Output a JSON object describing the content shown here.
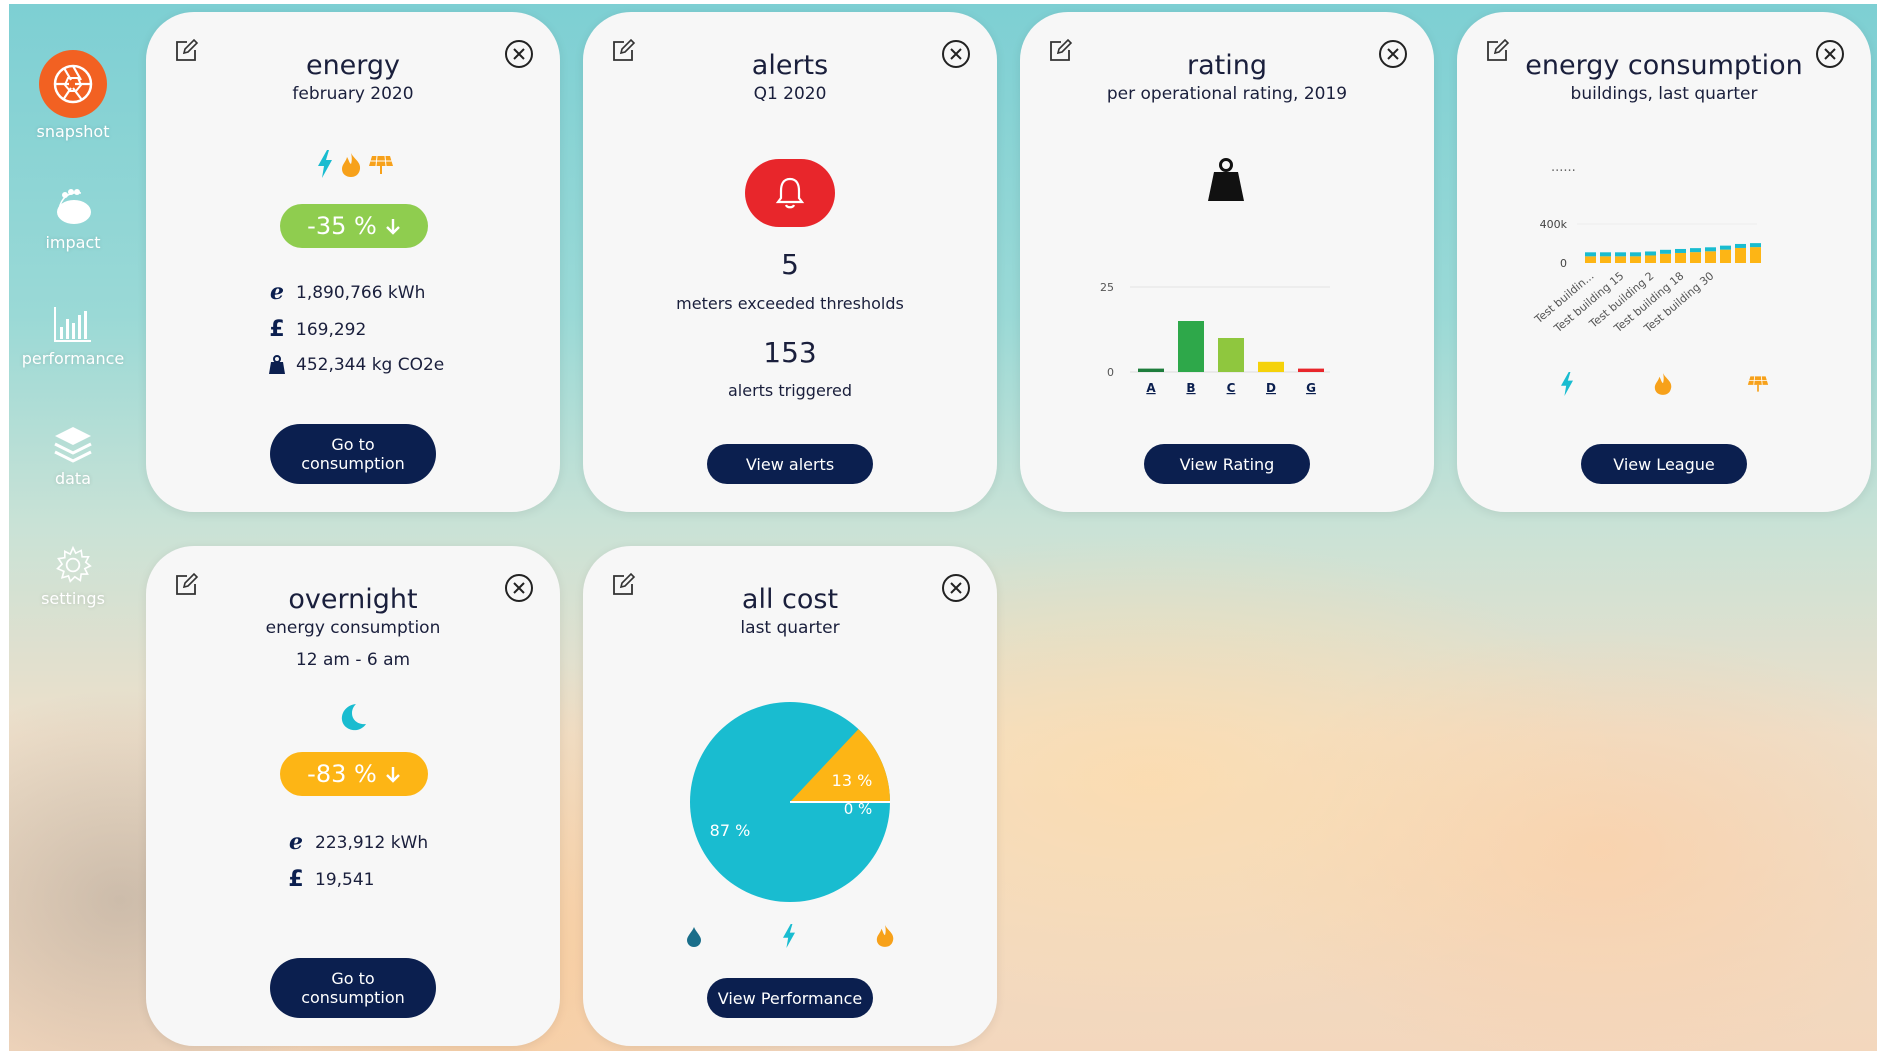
{
  "nav": {
    "items": [
      {
        "label": "snapshot",
        "icon": "shutter-icon"
      },
      {
        "label": "impact",
        "icon": "footprint-icon"
      },
      {
        "label": "performance",
        "icon": "bar-chart-icon"
      },
      {
        "label": "data",
        "icon": "layers-icon"
      },
      {
        "label": "settings",
        "icon": "gear-icon"
      }
    ]
  },
  "colors": {
    "navy": "#0b1f4f",
    "orange": "#f26122",
    "green": "#8fcd4f",
    "amber": "#fdb515",
    "teal": "#19bcd0",
    "red": "#e8262b"
  },
  "cards": {
    "energy": {
      "title": "energy",
      "subtitle": "february 2020",
      "change": "-35 %",
      "stats": [
        {
          "icon": "electricity-e-icon",
          "value": "1,890,766 kWh"
        },
        {
          "icon": "pound-icon",
          "value": "169,292"
        },
        {
          "icon": "co2-weight-icon",
          "value": "452,344 kg CO2e"
        }
      ],
      "button_label": "Go to consumption"
    },
    "alerts": {
      "title": "alerts",
      "subtitle": "Q1 2020",
      "meters_count": "5",
      "meters_label": "meters exceeded thresholds",
      "alerts_count": "153",
      "alerts_label": "alerts triggered",
      "button_label": "View alerts"
    },
    "rating": {
      "title": "rating",
      "subtitle": "per operational rating, 2019",
      "button_label": "View Rating"
    },
    "league": {
      "title": "energy consumption",
      "subtitle": "buildings, last quarter",
      "legend_text": "......",
      "button_label": "View League"
    },
    "overnight": {
      "title": "overnight",
      "subtitle": "energy consumption",
      "time_range": "12 am - 6 am",
      "change": "-83 %",
      "stats": [
        {
          "icon": "electricity-e-icon",
          "value": "223,912 kWh"
        },
        {
          "icon": "pound-icon",
          "value": "19,541"
        }
      ],
      "button_label": "Go to consumption"
    },
    "cost": {
      "title": "all cost",
      "subtitle": "last quarter",
      "button_label": "View Performance"
    }
  },
  "chart_data": [
    {
      "type": "bar",
      "categories": [
        "A",
        "B",
        "C",
        "D",
        "G"
      ],
      "values": [
        1,
        15,
        10,
        3,
        1
      ],
      "colors": [
        "#1e7d3c",
        "#2ea84a",
        "#8fc73e",
        "#f5d20a",
        "#e8262b"
      ],
      "ylim": [
        0,
        25
      ],
      "yticks": [
        "0",
        "25"
      ],
      "grid": true
    },
    {
      "type": "bar",
      "stacked": true,
      "categories": [
        "Test buildin...",
        "",
        "Test building 15",
        "",
        "Test building 2",
        "",
        "Test building 18",
        "",
        "Test building 30",
        "",
        "",
        ""
      ],
      "series": [
        {
          "values": [
            40,
            40,
            40,
            40,
            45,
            55,
            60,
            65,
            70,
            80,
            90,
            95
          ]
        },
        {
          "values": [
            40,
            40,
            40,
            40,
            45,
            45,
            45,
            45,
            45,
            45,
            45,
            45
          ]
        }
      ],
      "colors": [
        "#fdb515",
        "#19bcd0"
      ],
      "yticks": [
        "0",
        "400k"
      ],
      "legend_icons": [
        "bolt-icon",
        "flame-icon",
        "solar-panel-icon"
      ]
    },
    {
      "type": "pie",
      "slices": [
        {
          "value": 87,
          "label": "87 %",
          "color": "#19bcd0"
        },
        {
          "value": 13,
          "label": "13 %",
          "color": "#fdb515"
        },
        {
          "value": 0,
          "label": "0 %",
          "color": "#ffffff"
        }
      ],
      "legend_icons": [
        "water-drop-icon",
        "bolt-icon",
        "flame-icon"
      ]
    }
  ]
}
